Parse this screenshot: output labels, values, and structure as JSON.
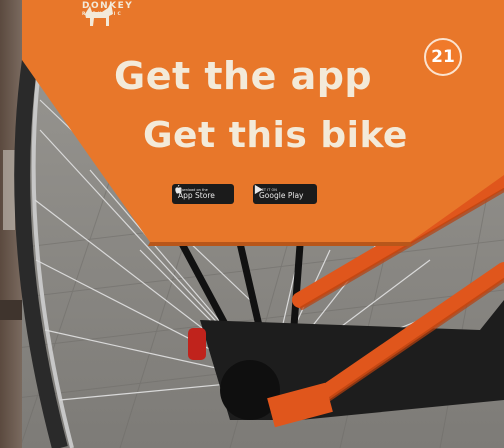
{
  "sign": {
    "brand_name": "DONKEY",
    "brand_sub": "REPUBLIC",
    "headline_1": "Get the app",
    "headline_2": "Get this bike",
    "badges": [
      {
        "small": "Download on the",
        "label": "App Store",
        "icon": "apple-icon"
      },
      {
        "small": "GET IT ON",
        "label": "Google Play",
        "icon": "google-play-icon"
      }
    ],
    "color": "#e8772a"
  },
  "page_number": "21",
  "colors": {
    "sign_orange": "#e8772a",
    "frame_orange": "#e0561c",
    "text_cream": "#f3ead9",
    "badge_circle": "#f07a2a"
  }
}
